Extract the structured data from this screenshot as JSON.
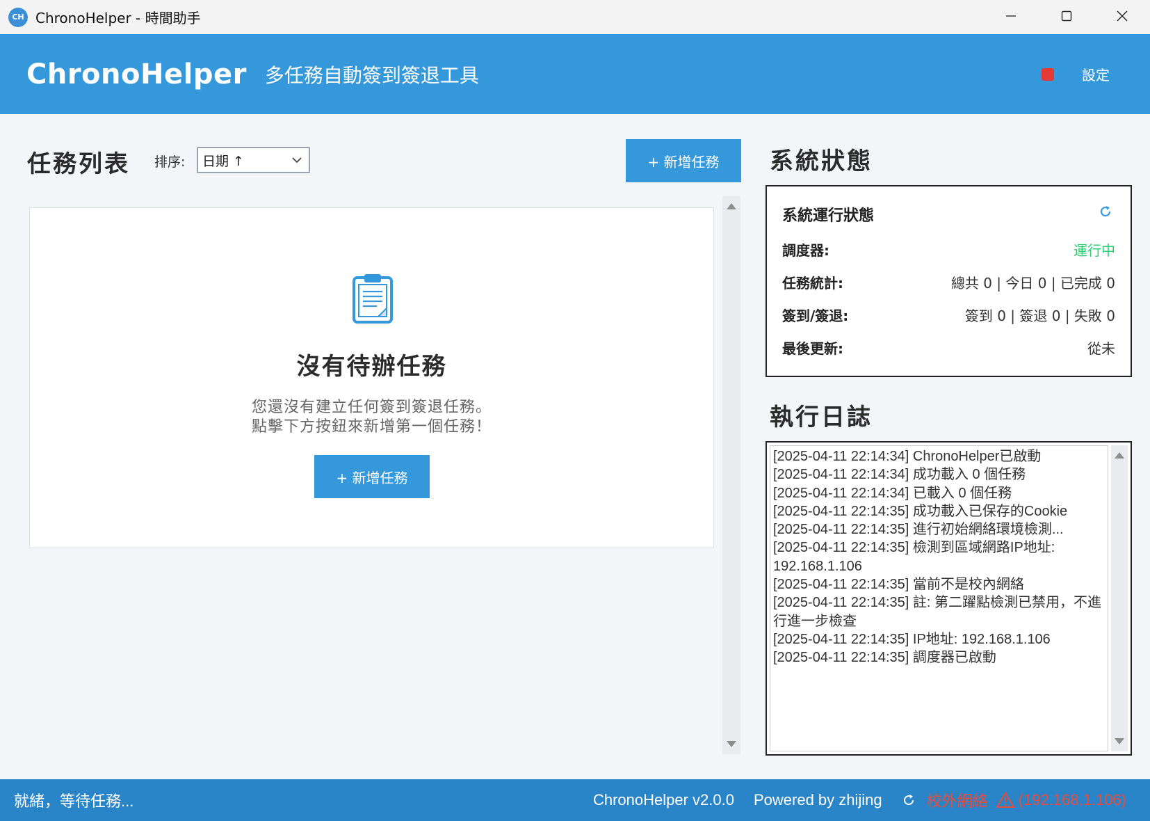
{
  "window": {
    "icon_text": "CH",
    "title": "ChronoHelper - 時間助手"
  },
  "header": {
    "brand": "ChronoHelper",
    "subtitle": "多任務自動簽到簽退工具",
    "settings_label": "設定"
  },
  "tasks": {
    "title": "任務列表",
    "sort_label": "排序:",
    "sort_value": "日期 ↑",
    "add_button": "+ 新增任務",
    "empty_title": "沒有待辦任務",
    "empty_line1": "您還沒有建立任何簽到簽退任務。",
    "empty_line2": "點擊下方按鈕來新增第一個任務！",
    "empty_add_button": "+ 新增任務"
  },
  "system": {
    "title": "系統狀態",
    "box_title": "系統運行狀態",
    "rows": [
      {
        "key": "調度器:",
        "value": "運行中"
      },
      {
        "key": "任務統計:",
        "value": "總共 0 | 今日 0 | 已完成 0"
      },
      {
        "key": "簽到/簽退:",
        "value": "簽到 0 | 簽退 0 | 失敗 0"
      },
      {
        "key": "最後更新:",
        "value": "從未"
      }
    ],
    "colors": {
      "running": "#2ecc71",
      "accent": "#3598db"
    }
  },
  "log": {
    "title": "執行日誌",
    "lines": [
      "[2025-04-11 22:14:34] ChronoHelper已啟動",
      "[2025-04-11 22:14:34] 成功載入 0 個任務",
      "[2025-04-11 22:14:34] 已載入 0 個任務",
      "[2025-04-11 22:14:35] 成功載入已保存的Cookie",
      "[2025-04-11 22:14:35] 進行初始網絡環境檢測...",
      "[2025-04-11 22:14:35] 檢測到區域網路IP地址: 192.168.1.106",
      "[2025-04-11 22:14:35] 當前不是校內網絡",
      "[2025-04-11 22:14:35] 註: 第二躍點檢測已禁用，不進行進一步檢查",
      "[2025-04-11 22:14:35] IP地址: 192.168.1.106",
      "[2025-04-11 22:14:35] 調度器已啟動"
    ]
  },
  "statusbar": {
    "status": "就緒，等待任務...",
    "version": "ChronoHelper v2.0.0",
    "powered": "Powered by zhijing",
    "network": "校外網絡",
    "ip": "(192.168.1.106)",
    "colors": {
      "warning": "#e74c3c"
    }
  }
}
